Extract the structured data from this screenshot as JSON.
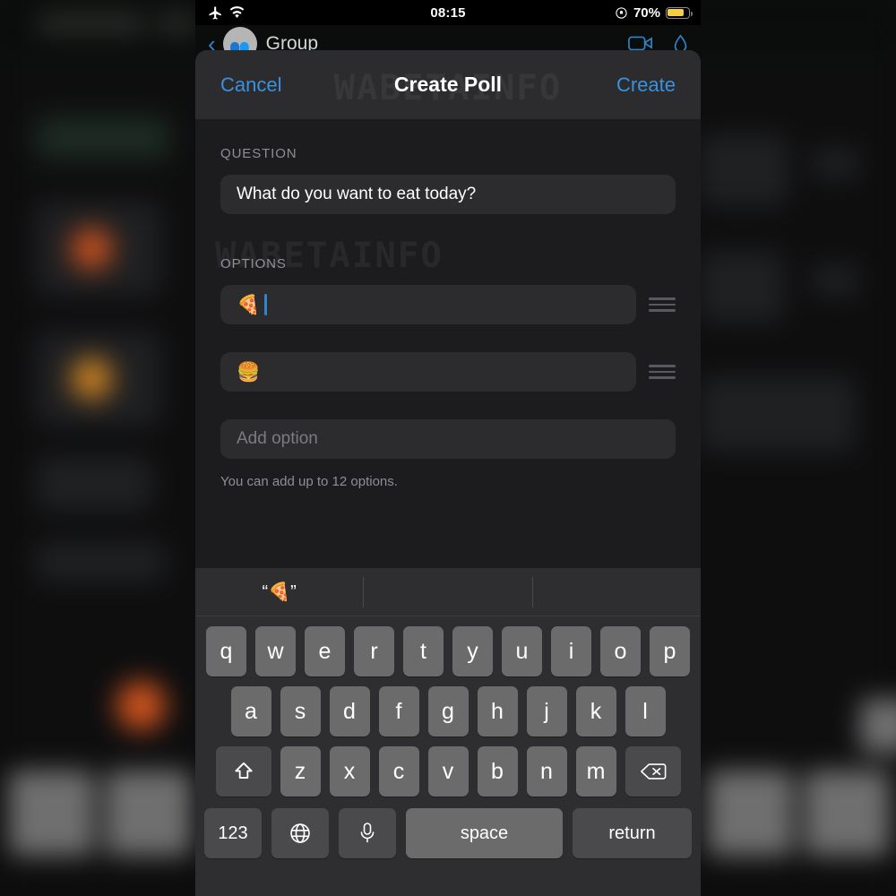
{
  "status_bar": {
    "airplane_icon": "airplane-mode-icon",
    "wifi_icon": "wifi-icon",
    "time": "08:15",
    "rotation_lock_icon": "rotation-lock-icon",
    "battery_percent": "70%",
    "battery_level": 70,
    "battery_color": "#f6ce46"
  },
  "chat_header": {
    "back_icon": "back-chevron-icon",
    "avatar_label": "group-avatar",
    "title": "Group",
    "video_call_icon": "video-call-icon",
    "voice_call_icon": "voice-call-icon"
  },
  "modal": {
    "watermark": "WABETAINFO",
    "cancel_label": "Cancel",
    "title": "Create Poll",
    "create_label": "Create",
    "accent_color": "#3a91dd",
    "sheet_bg": "#1c1c1e",
    "field_bg": "#2c2c2e"
  },
  "question": {
    "section_label": "QUESTION",
    "value": "What do you want to eat today?"
  },
  "options": {
    "section_label": "OPTIONS",
    "items": [
      {
        "value": "🍕",
        "emoji_name": "pizza-emoji",
        "focused": true
      },
      {
        "value": "🍔",
        "emoji_name": "hamburger-emoji",
        "focused": false
      }
    ],
    "add_placeholder": "Add option",
    "hint": "You can add up to 12 options.",
    "max_options": 12,
    "drag_handle_icon": "drag-handle-icon"
  },
  "keyboard": {
    "predictions": [
      "“🍕”",
      "",
      ""
    ],
    "row1": [
      "q",
      "w",
      "e",
      "r",
      "t",
      "y",
      "u",
      "i",
      "o",
      "p"
    ],
    "row2": [
      "a",
      "s",
      "d",
      "f",
      "g",
      "h",
      "j",
      "k",
      "l"
    ],
    "row3": [
      "z",
      "x",
      "c",
      "v",
      "b",
      "n",
      "m"
    ],
    "shift_icon": "shift-icon",
    "backspace_icon": "backspace-icon",
    "numbers_label": "123",
    "globe_icon": "globe-icon",
    "microphone_icon": "microphone-icon",
    "space_label": "space",
    "return_label": "return"
  }
}
